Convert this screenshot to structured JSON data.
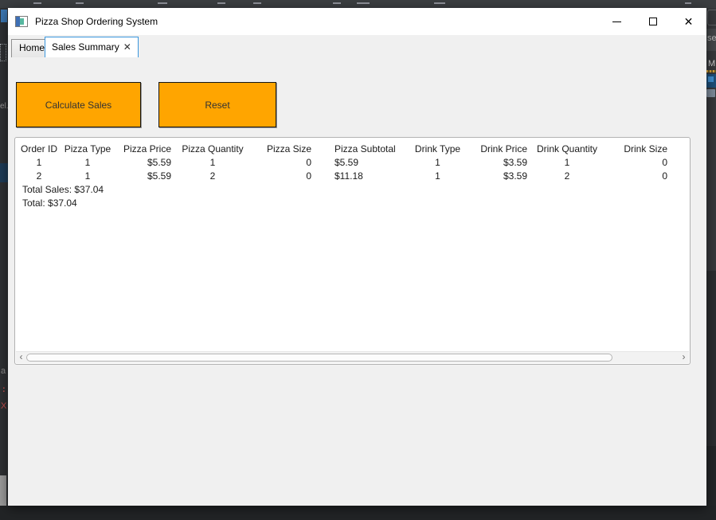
{
  "window": {
    "title": "Pizza Shop Ordering System"
  },
  "titlebar_controls": {
    "close_glyph": "✕"
  },
  "tabs": {
    "home_label": "Home",
    "sales_summary_label": "Sales Summary",
    "close_glyph": "✕"
  },
  "toolbar": {
    "calculate_label": "Calculate Sales",
    "reset_label": "Reset"
  },
  "sales_table": {
    "columns": [
      "Order ID",
      "Pizza Type",
      "Pizza Price",
      "Pizza Quantity",
      "Pizza Size",
      "Pizza Subtotal",
      "Drink Type",
      "Drink Price",
      "Drink Quantity",
      "Drink Size"
    ],
    "rows": [
      [
        "1",
        "1",
        "$5.59",
        "1",
        "0",
        "$5.59",
        "1",
        "$3.59",
        "1",
        "0"
      ],
      [
        "2",
        "1",
        "$5.59",
        "2",
        "0",
        "$11.18",
        "1",
        "$3.59",
        "2",
        "0"
      ]
    ],
    "total_sales_line": "Total Sales: $37.04",
    "total_line": "Total: $37.04"
  },
  "scrollbar": {
    "left_arrow": "‹",
    "right_arrow": "›"
  },
  "colors": {
    "button_orange": "#FFA500",
    "active_tab_border": "#3A96DD",
    "titlebar_bg": "#FFFFFF",
    "window_bg": "#F0F0F0",
    "desktop_dark": "#2F3134"
  },
  "background_fragments": {
    "right_se": "se",
    "right_m": "M",
    "left_el": "el.",
    "left_a": "a",
    "left_colon": ":",
    "left_x": "X"
  }
}
